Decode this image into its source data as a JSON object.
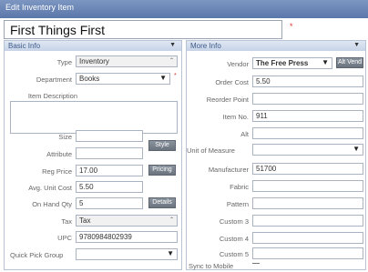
{
  "window": {
    "title": "Edit Inventory Item"
  },
  "item_name": "First Things First",
  "required_mark": "*",
  "basic": {
    "header": "Basic Info",
    "type_label": "Type",
    "type_value": "Inventory",
    "department_label": "Department",
    "department_value": "Books",
    "item_description_label": "Item Description",
    "item_description_value": "",
    "size_label": "Size",
    "size_value": "",
    "attribute_label": "Attribute",
    "attribute_value": "",
    "style_button": "Style",
    "reg_price_label": "Reg Price",
    "reg_price_value": "17.00",
    "pricing_button": "Pricing",
    "avg_cost_label": "Avg. Unit Cost",
    "avg_cost_value": "5.50",
    "on_hand_label": "On Hand Qty",
    "on_hand_value": "5",
    "details_button": "Details",
    "tax_label": "Tax",
    "tax_value": "Tax",
    "upc_label": "UPC",
    "upc_value": "9780984802939",
    "quick_pick_label": "Quick Pick Group",
    "quick_pick_value": ""
  },
  "more": {
    "header": "More Info",
    "vendor_label": "Vendor",
    "vendor_value": "The Free Press",
    "alt_vend_button": "Alt Vend",
    "order_cost_label": "Order Cost",
    "order_cost_value": "5.50",
    "reorder_point_label": "Reorder Point",
    "reorder_point_value": "",
    "item_no_label": "Item No.",
    "item_no_value": "911",
    "alt_label": "Alt",
    "alt_value": "",
    "unit_measure_label": "Unit of Measure",
    "unit_measure_value": "",
    "manufacturer_label": "Manufacturer",
    "manufacturer_value": "51700",
    "fabric_label": "Fabric",
    "fabric_value": "",
    "pattern_label": "Pattern",
    "pattern_value": "",
    "custom3_label": "Custom 3",
    "custom3_value": "",
    "custom4_label": "Custom 4",
    "custom4_value": "",
    "custom5_label": "Custom 5",
    "custom5_value": "",
    "sync_label": "Sync to Mobile"
  },
  "colors": {
    "title_bar": "#6a86b8",
    "panel_header": "#d2dded",
    "required": "#dd3333"
  }
}
